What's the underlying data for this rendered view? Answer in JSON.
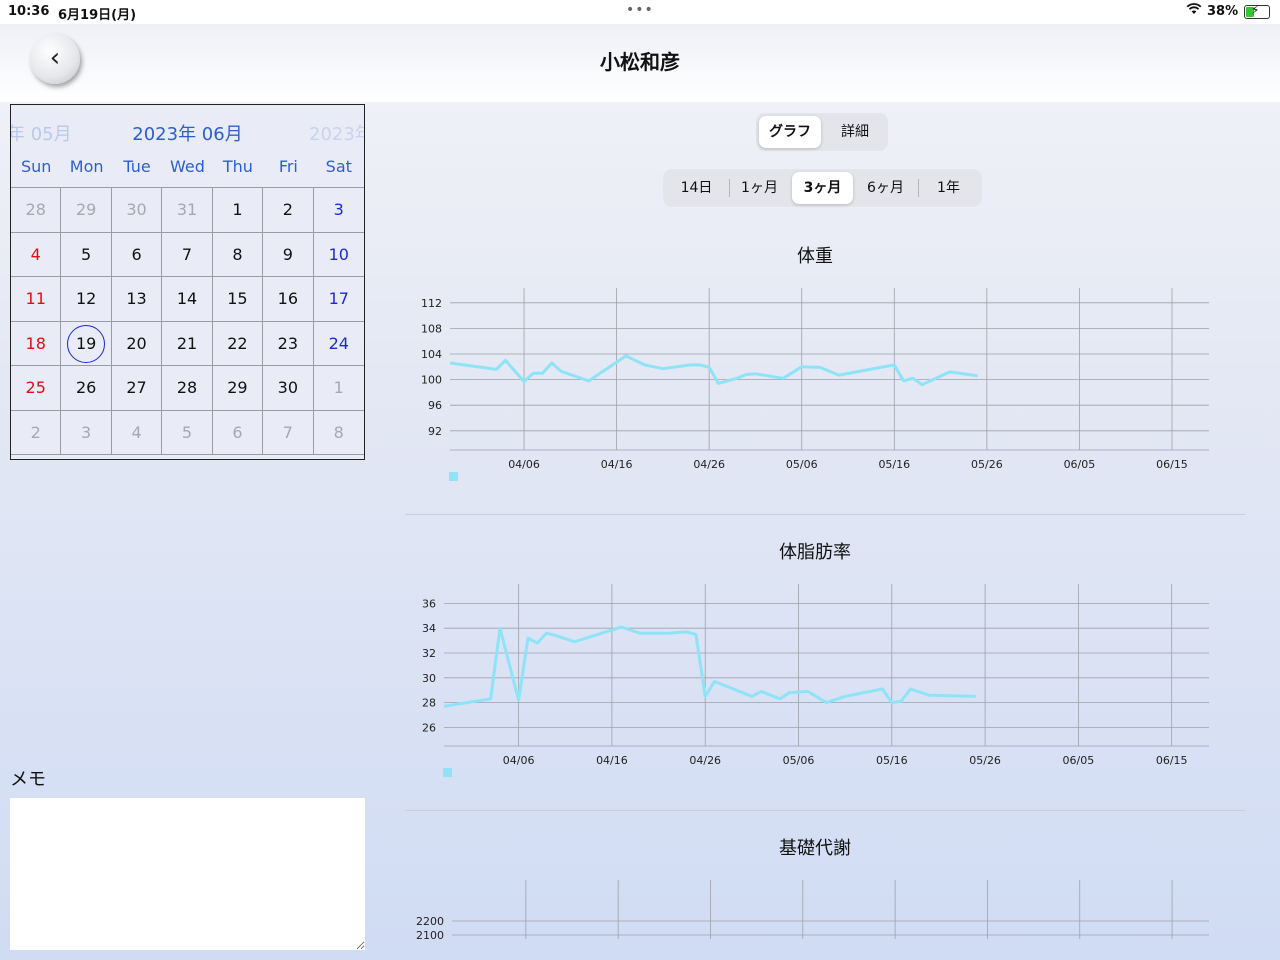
{
  "status_bar": {
    "time": "10:36",
    "date": "6月19日(月)",
    "dots": "•••",
    "battery_pct": "38%",
    "battery_level": 0.38
  },
  "header": {
    "back_label": "‹",
    "title": "小松和彦"
  },
  "calendar": {
    "prev_month": "年 05月",
    "current_month": "2023年 06月",
    "next_month": "2023年",
    "weekdays": [
      "Sun",
      "Mon",
      "Tue",
      "Wed",
      "Thu",
      "Fri",
      "Sat"
    ],
    "days": [
      {
        "d": "28",
        "t": "other"
      },
      {
        "d": "29",
        "t": "other"
      },
      {
        "d": "30",
        "t": "other"
      },
      {
        "d": "31",
        "t": "other"
      },
      {
        "d": "1",
        "t": ""
      },
      {
        "d": "2",
        "t": ""
      },
      {
        "d": "3",
        "t": "sat"
      },
      {
        "d": "4",
        "t": "sun"
      },
      {
        "d": "5",
        "t": ""
      },
      {
        "d": "6",
        "t": ""
      },
      {
        "d": "7",
        "t": ""
      },
      {
        "d": "8",
        "t": ""
      },
      {
        "d": "9",
        "t": ""
      },
      {
        "d": "10",
        "t": "sat"
      },
      {
        "d": "11",
        "t": "sun"
      },
      {
        "d": "12",
        "t": ""
      },
      {
        "d": "13",
        "t": ""
      },
      {
        "d": "14",
        "t": ""
      },
      {
        "d": "15",
        "t": ""
      },
      {
        "d": "16",
        "t": ""
      },
      {
        "d": "17",
        "t": "sat"
      },
      {
        "d": "18",
        "t": "sun"
      },
      {
        "d": "19",
        "t": "today"
      },
      {
        "d": "20",
        "t": ""
      },
      {
        "d": "21",
        "t": ""
      },
      {
        "d": "22",
        "t": ""
      },
      {
        "d": "23",
        "t": ""
      },
      {
        "d": "24",
        "t": "sat"
      },
      {
        "d": "25",
        "t": "sun"
      },
      {
        "d": "26",
        "t": ""
      },
      {
        "d": "27",
        "t": ""
      },
      {
        "d": "28",
        "t": ""
      },
      {
        "d": "29",
        "t": ""
      },
      {
        "d": "30",
        "t": ""
      },
      {
        "d": "1",
        "t": "other"
      },
      {
        "d": "2",
        "t": "other"
      },
      {
        "d": "3",
        "t": "other"
      },
      {
        "d": "4",
        "t": "other"
      },
      {
        "d": "5",
        "t": "other"
      },
      {
        "d": "6",
        "t": "other"
      },
      {
        "d": "7",
        "t": "other"
      },
      {
        "d": "8",
        "t": "other"
      }
    ]
  },
  "memo": {
    "label": "メモ",
    "value": ""
  },
  "view_toggle": {
    "graph": "グラフ",
    "detail": "詳細"
  },
  "range_tabs": [
    "14日",
    "1ヶ月",
    "3ヶ月",
    "6ヶ月",
    "1年"
  ],
  "range_selected": 2,
  "colors": {
    "line": "#8fe3f7",
    "grid": "#9ea1a8",
    "accent": "#2b5fd1",
    "sunday": "#e01010",
    "saturday": "#1a2ad0"
  },
  "chart_data": [
    {
      "type": "line",
      "title": "体重",
      "x_ticks": [
        "04/06",
        "04/16",
        "04/26",
        "05/06",
        "05/16",
        "05/26",
        "06/05",
        "06/15"
      ],
      "x_tick_offsets": [
        0,
        10,
        20,
        30,
        40,
        50,
        60,
        70
      ],
      "xlim": [
        -8,
        74
      ],
      "y_ticks": [
        92,
        96,
        100,
        104,
        108,
        112
      ],
      "ylim": [
        89,
        114
      ],
      "legend": "square",
      "series": [
        {
          "x": [
            -8,
            -3,
            -2,
            0,
            1,
            2,
            3,
            4,
            7,
            11,
            13,
            15,
            18,
            19,
            20,
            21,
            23,
            24,
            25,
            28,
            30,
            32,
            34,
            40,
            41,
            42,
            43,
            46,
            49
          ],
          "y": [
            102.6,
            101.6,
            103,
            99.7,
            101,
            101,
            102.6,
            101.3,
            99.8,
            103.7,
            102.3,
            101.7,
            102.3,
            102.3,
            101.9,
            99.4,
            100.2,
            100.8,
            100.9,
            100.2,
            102,
            101.9,
            100.7,
            102.3,
            99.8,
            100.2,
            99.2,
            101.2,
            100.6
          ]
        }
      ]
    },
    {
      "type": "line",
      "title": "体脂肪率",
      "x_ticks": [
        "04/06",
        "04/16",
        "04/26",
        "05/06",
        "05/16",
        "05/26",
        "06/05",
        "06/15"
      ],
      "x_tick_offsets": [
        0,
        10,
        20,
        30,
        40,
        50,
        60,
        70
      ],
      "xlim": [
        -8,
        74
      ],
      "y_ticks": [
        26,
        28,
        30,
        32,
        34,
        36
      ],
      "ylim": [
        24.5,
        37
      ],
      "legend": "square",
      "series": [
        {
          "x": [
            -8,
            -3,
            -2,
            0,
            1,
            2,
            3,
            4,
            6,
            11,
            13,
            16,
            18,
            19,
            20,
            21,
            25,
            26,
            28,
            29,
            31,
            33,
            35,
            39,
            40,
            41,
            42,
            44,
            49
          ],
          "y": [
            27.7,
            28.3,
            34,
            28.2,
            33.2,
            32.8,
            33.6,
            33.4,
            32.9,
            34.1,
            33.6,
            33.6,
            33.7,
            33.5,
            28.5,
            29.7,
            28.5,
            28.9,
            28.3,
            28.8,
            28.9,
            28,
            28.5,
            29.1,
            28,
            28.1,
            29.1,
            28.6,
            28.5
          ]
        }
      ]
    },
    {
      "type": "line",
      "title": "基礎代謝",
      "x_tick_offsets": [
        0,
        10,
        20,
        30,
        40,
        50,
        60,
        70
      ],
      "xlim": [
        -8,
        74
      ],
      "y_ticks": [
        2100,
        2200
      ],
      "ylim": [
        2100,
        2300
      ],
      "series": []
    }
  ]
}
